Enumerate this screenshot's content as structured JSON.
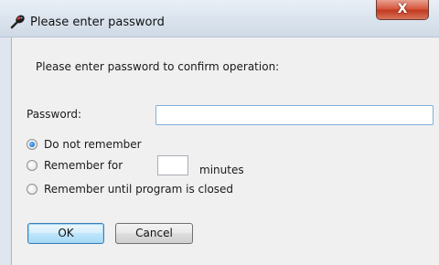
{
  "window": {
    "title": "Please enter password",
    "close_label": "X",
    "app_icon": "key-icon"
  },
  "dialog": {
    "prompt": "Please enter password to confirm operation:",
    "password_label": "Password:",
    "password_value": "",
    "remember_options": [
      {
        "label": "Do not remember",
        "checked": true
      },
      {
        "label": "Remember for",
        "checked": false
      },
      {
        "label": "Remember until program is closed",
        "checked": false
      }
    ],
    "minutes_value": "",
    "minutes_label": "minutes",
    "ok_label": "OK",
    "cancel_label": "Cancel"
  },
  "colors": {
    "accent": "#3c7fb1",
    "close": "#c23a20"
  }
}
